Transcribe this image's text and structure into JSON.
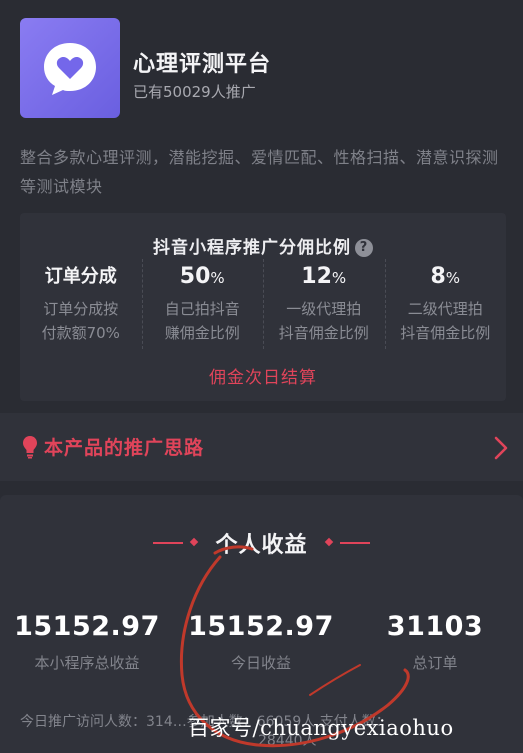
{
  "header": {
    "title": "心理评测平台",
    "subtitle": "已有50029人推广",
    "icon": "heart-chat-bubble-icon"
  },
  "description": "整合多款心理评测，潜能挖掘、爱情匹配、性格扫描、潜意识探测等测试模块",
  "commission": {
    "title": "抖音小程序推广分佣比例",
    "columns": [
      {
        "head": "订单分成",
        "pct": "",
        "line1": "订单分成按",
        "line2": "付款额70%"
      },
      {
        "head": "50",
        "pct": "%",
        "line1": "自己拍抖音",
        "line2": "赚佣金比例"
      },
      {
        "head": "12",
        "pct": "%",
        "line1": "一级代理拍",
        "line2": "抖音佣金比例"
      },
      {
        "head": "8",
        "pct": "%",
        "line1": "二级代理拍",
        "line2": "抖音佣金比例"
      }
    ],
    "settle_note": "佣金次日结算"
  },
  "promo": {
    "label": "本产品的推广思路"
  },
  "earnings": {
    "title": "个人收益",
    "stats": [
      {
        "value": "15152.97",
        "label": "本小程序总收益"
      },
      {
        "value": "15152.97",
        "label": "今日收益"
      },
      {
        "value": "31103",
        "label": "总订单"
      }
    ],
    "footer_line1": "今日推广访问人数：314…参加人数：66059人 支付人数：",
    "footer_line2": "28440人"
  },
  "watermark": "百家号/chuangyexiaohuo",
  "colors": {
    "background": "#2a2c33",
    "card": "#30323a",
    "accent": "#e0445a",
    "icon_bg": "#7b6ef0"
  }
}
